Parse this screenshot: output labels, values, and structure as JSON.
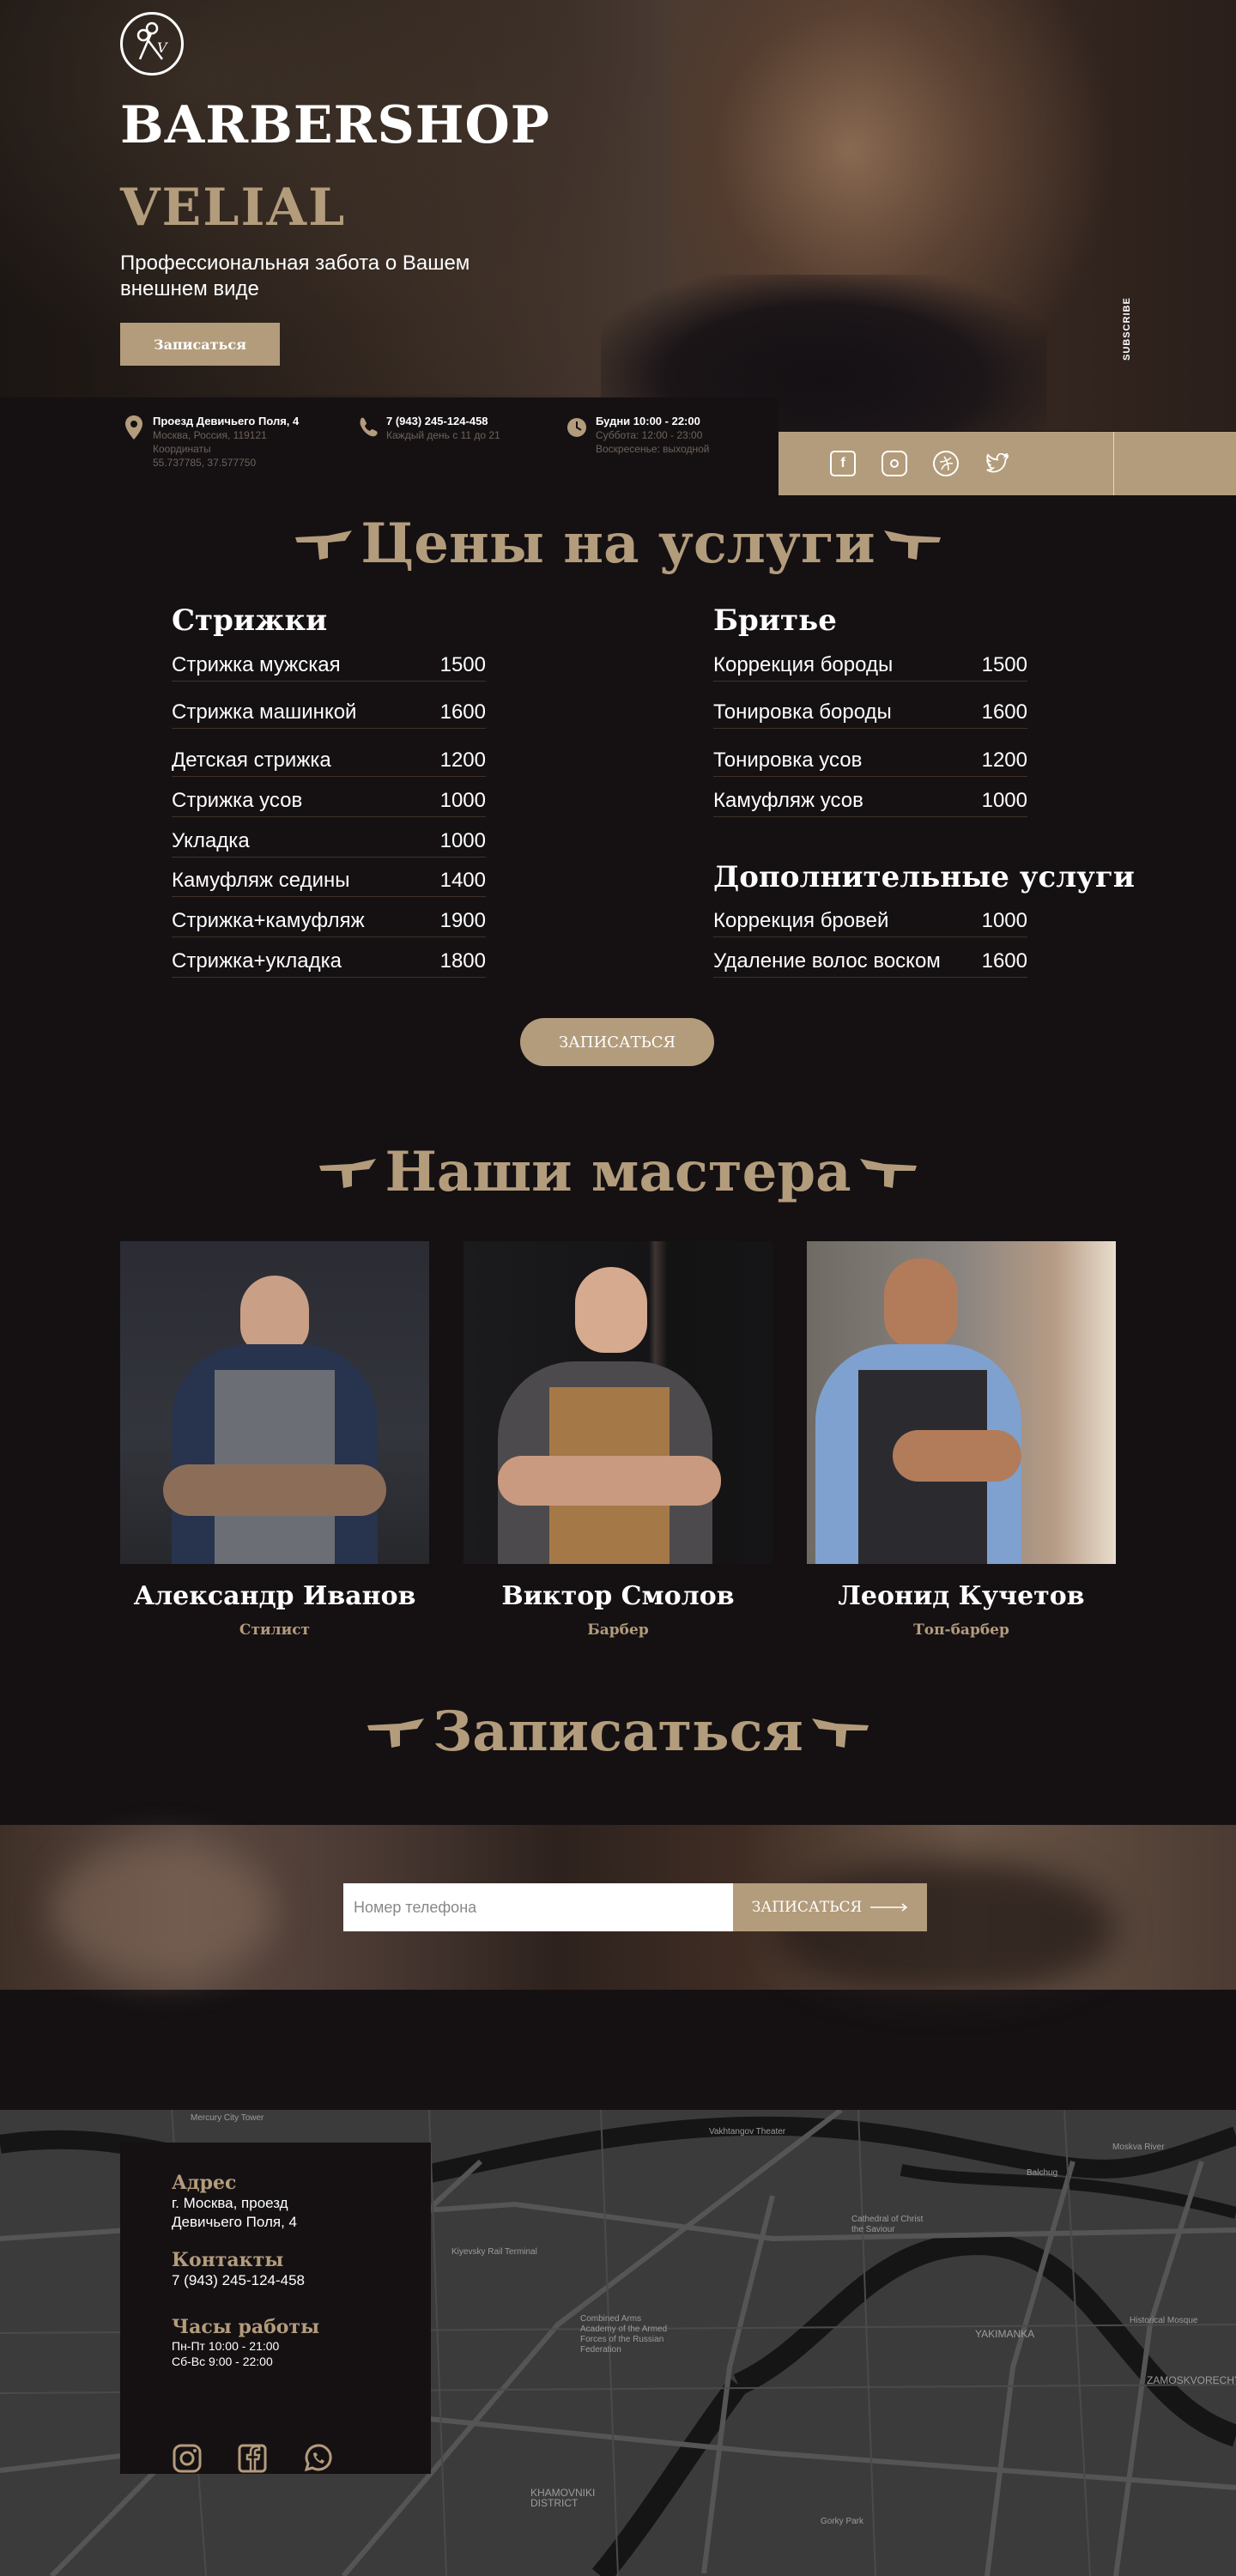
{
  "hero": {
    "title_line1": "BARBERSHOP",
    "title_line2": "VELIAL",
    "subtitle": "Профессиональная забота о Вашем внешнем виде",
    "cta_label": "Записаться",
    "side_label": "SUBSCRIBE"
  },
  "info": {
    "address_title": "Проезд Девичьего Поля, 4",
    "address_city": "Москва, Россия, 119121",
    "address_coords_label": "Координаты",
    "address_coords": "55.737785, 37.577750",
    "phone_title": "7 (943) 245-124-458",
    "phone_hours": "Каждый день с 11 до 21",
    "hours_title": "Будни 10:00 - 22:00",
    "hours_sat": "Суббота: 12:00 - 23:00",
    "hours_sun": "Воскресенье: выходной"
  },
  "social": [
    "facebook-icon",
    "instagram-icon",
    "dribbble-icon",
    "twitter-icon"
  ],
  "prices": {
    "section_title": "Цены на услуги",
    "haircuts_title": "Стрижки",
    "haircuts": [
      {
        "name": "Стрижка мужская",
        "price": "1500"
      },
      {
        "name": "Стрижка машинкой",
        "price": "1600"
      },
      {
        "name": "Детская стрижка",
        "price": "1200"
      },
      {
        "name": "Стрижка усов",
        "price": "1000"
      },
      {
        "name": "Укладка",
        "price": "1000"
      },
      {
        "name": "Камуфляж седины",
        "price": "1400"
      },
      {
        "name": "Стрижка+камуфляж",
        "price": "1900"
      },
      {
        "name": "Стрижка+укладка",
        "price": "1800"
      }
    ],
    "shaving_title": "Бритье",
    "shaving": [
      {
        "name": "Коррекция бороды",
        "price": "1500"
      },
      {
        "name": "Тонировка бороды",
        "price": "1600"
      },
      {
        "name": "Тонировка усов",
        "price": "1200"
      },
      {
        "name": "Камуфляж усов",
        "price": "1000"
      }
    ],
    "extra_title": "Дополнительные услуги",
    "extra": [
      {
        "name": "Коррекция бровей",
        "price": "1000"
      },
      {
        "name": "Удаление волос воском",
        "price": "1600"
      }
    ],
    "cta_label": "ЗАПИСАТЬСЯ"
  },
  "masters": {
    "section_title": "Наши мастера",
    "items": [
      {
        "name": "Александр Иванов",
        "role": "Стилист"
      },
      {
        "name": "Виктор Смолов",
        "role": "Барбер"
      },
      {
        "name": "Леонид Кучетов",
        "role": "Топ-барбер"
      }
    ]
  },
  "booking": {
    "section_title": "Записаться",
    "phone_placeholder": "Номер телефона",
    "submit_label": "ЗАПИСАТЬСЯ"
  },
  "contacts": {
    "address_title": "Адрес",
    "address_line1": "г. Москва, проезд",
    "address_line2": "Девичьего Поля, 4",
    "contacts_title": "Контакты",
    "phone": "7 (943) 245-124-458",
    "hours_title": "Часы работы",
    "hours_weekdays": "Пн-Пт 10:00 - 21:00",
    "hours_weekend": "Сб-Вс 9:00 - 22:00",
    "social": [
      "instagram-icon",
      "facebook-icon",
      "whatsapp-icon"
    ]
  },
  "map": {
    "labels": [
      "Mercury City Tower",
      "Vakhtangov Theater",
      "Kiyevsky Rail Terminal",
      "Cathedral of Christ the Saviour",
      "Combined Arms Academy of the Armed Forces of the Russian Federation",
      "YAKIMANKA",
      "ZAMOSKVORECHYE",
      "Historical Mosque",
      "KHAMOVNIKI DISTRICT",
      "Gorky Park",
      "Balchug",
      "Moskva River"
    ]
  },
  "colors": {
    "accent": "#b39c7c",
    "background": "#151113"
  }
}
